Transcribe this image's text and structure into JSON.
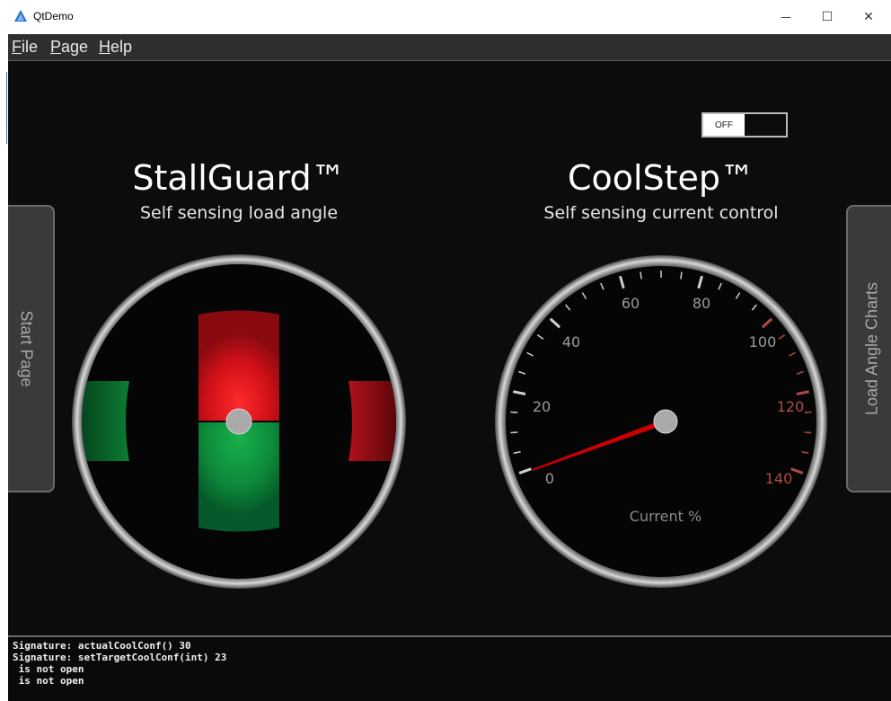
{
  "window": {
    "title": "QtDemo",
    "minimize_glyph": "—",
    "maximize_glyph": "☐",
    "close_glyph": "✕"
  },
  "menu": {
    "file": {
      "mnemonic": "F",
      "rest": "ile"
    },
    "page": {
      "mnemonic": "P",
      "rest": "age"
    },
    "help": {
      "mnemonic": "H",
      "rest": "elp"
    }
  },
  "toggle": {
    "label": "OFF",
    "state": "off"
  },
  "stallguard": {
    "title": "StallGuard™",
    "subtitle": "Self sensing load angle"
  },
  "coolstep": {
    "title": "CoolStep™",
    "subtitle": "Self sensing current control",
    "gauge": {
      "labels": [
        "0",
        "20",
        "40",
        "60",
        "80",
        "100",
        "120",
        "140"
      ],
      "unit_label": "Current %",
      "min": 0,
      "max": 140,
      "needle_value": 0,
      "warning_from": 100,
      "normal_color": "#9a9a9a",
      "warning_color": "#b04a45",
      "needle_color": "#cc0000"
    }
  },
  "nav": {
    "left_tab": "Start Page",
    "right_tab": "Load Angle Charts"
  },
  "console": {
    "lines": [
      "Signature: actualCoolConf() 30",
      "Signature: setTargetCoolConf(int) 23",
      " is not open",
      " is not open"
    ]
  },
  "colors": {
    "background": "#0c0c0c",
    "red": "#d01018",
    "green": "#0d8a3a"
  }
}
